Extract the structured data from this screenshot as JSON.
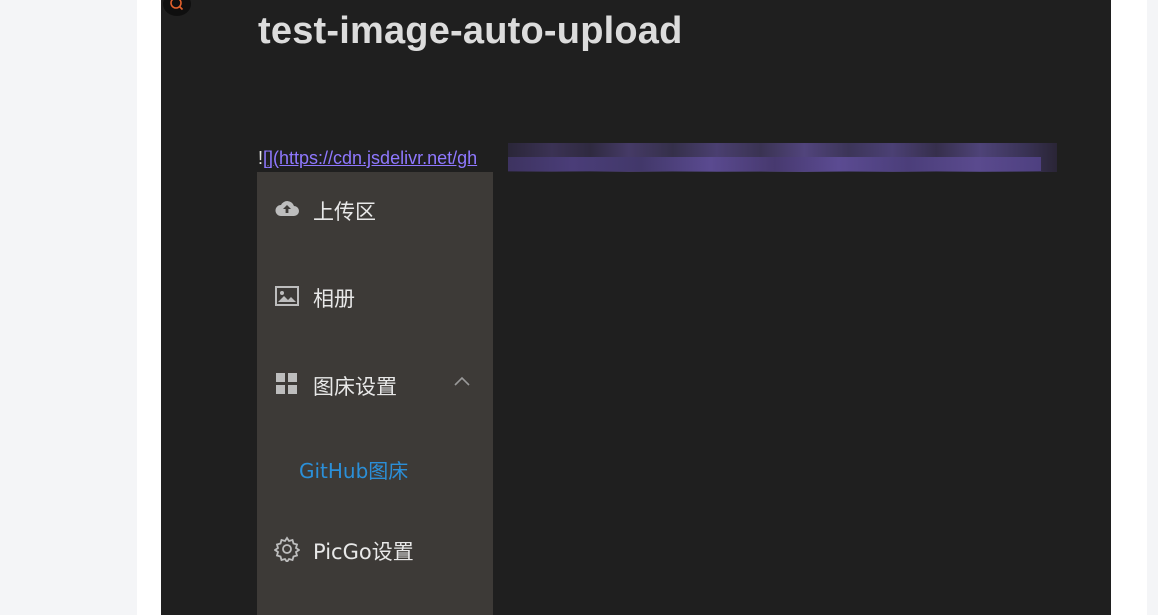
{
  "document": {
    "title": "test-image-auto-upload",
    "markdown_bang": "!",
    "markdown_link_text": "[](https://cdn.jsdelivr.net/gh"
  },
  "embedded_screenshot": {
    "menu": [
      {
        "label": "上传区",
        "icon": "cloud-upload-icon"
      },
      {
        "label": "相册",
        "icon": "image-icon"
      },
      {
        "label": "图床设置",
        "icon": "grid-icon",
        "expanded": true
      },
      {
        "label": "PicGo设置",
        "icon": "gear-icon"
      }
    ],
    "submenu": [
      {
        "label": "GitHub图床"
      }
    ],
    "colors": {
      "sidebar_bg": "#3d3a37",
      "submenu_active": "#2b8fd8",
      "editor_bg": "#1f1f1f",
      "link": "#8f78ff"
    }
  },
  "icons": {
    "search_badge": "search-icon"
  }
}
